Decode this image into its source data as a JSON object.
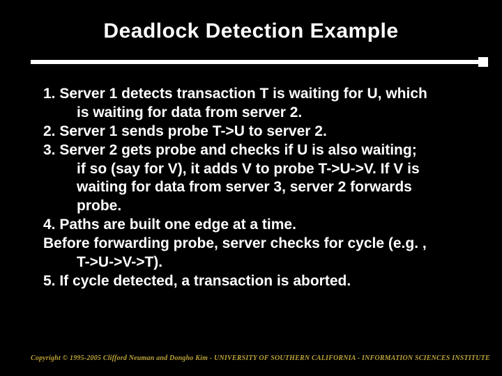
{
  "title": "Deadlock Detection Example",
  "lines": {
    "l1": "1. Server 1 detects transaction T is waiting for U, which",
    "l1b": "is waiting for data from server 2.",
    "l2": "2. Server 1 sends probe T->U to server 2.",
    "l3": "3. Server 2 gets probe and checks if U is also waiting;",
    "l3b": "if so (say for V), it adds V to probe T->U->V. If V is",
    "l3c": "waiting for data from server 3, server 2 forwards",
    "l3d": "probe.",
    "l4": "4. Paths are built one edge at a time.",
    "l5": "Before forwarding probe, server checks for cycle (e.g. ,",
    "l5b": "T->U->V->T).",
    "l6": "5. If cycle detected, a transaction is aborted."
  },
  "footer": "Copyright © 1995-2005 Clifford Neuman and Dongho Kim - UNIVERSITY OF SOUTHERN CALIFORNIA - INFORMATION SCIENCES INSTITUTE"
}
